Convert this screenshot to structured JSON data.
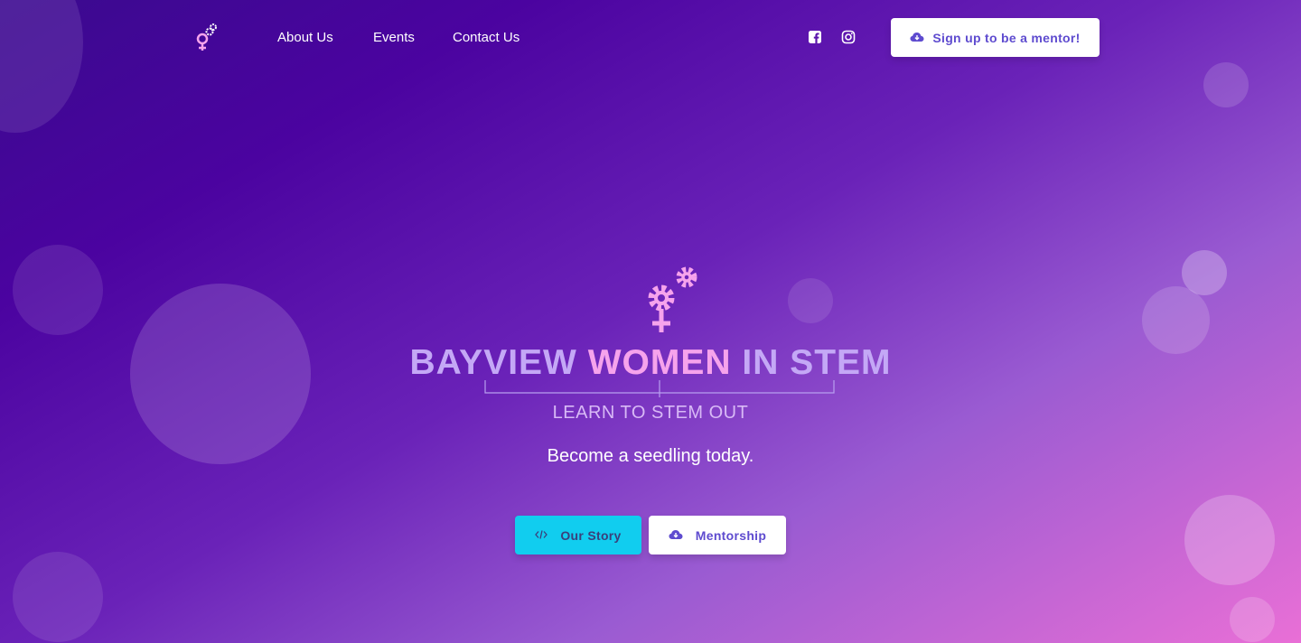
{
  "nav": {
    "links": [
      "About Us",
      "Events",
      "Contact Us"
    ],
    "social_icons": [
      "facebook-icon",
      "instagram-icon"
    ],
    "cta": {
      "label": "Sign up to be a mentor!",
      "icon": "cloud-download-icon"
    }
  },
  "hero": {
    "title_part1": "BAYVIEW",
    "title_part2": "WOMEN",
    "title_part3": "IN STEM",
    "tagline": "LEARN TO STEM OUT",
    "subtitle": "Become a seedling today.",
    "buttons": [
      {
        "label": "Our Story",
        "icon": "code-icon"
      },
      {
        "label": "Mentorship",
        "icon": "cloud-download-icon"
      }
    ]
  },
  "colors": {
    "accent_pink": "#f6a3ec",
    "accent_cyan": "#11cdef",
    "button_text_purple": "#5e4bcf",
    "title_lavender": "#c4a8f6"
  }
}
